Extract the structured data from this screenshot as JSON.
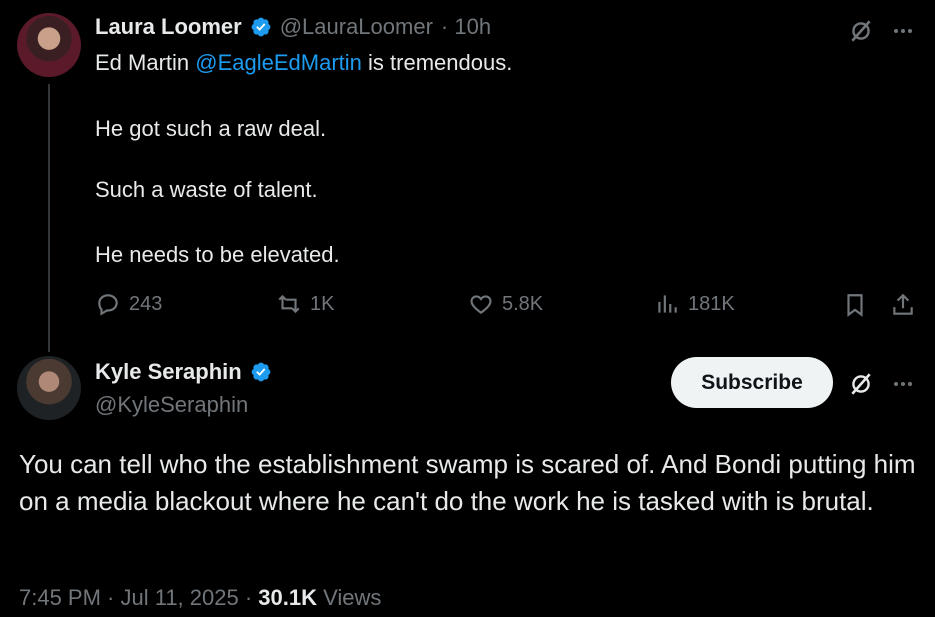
{
  "parent": {
    "name": "Laura Loomer",
    "handle": "@LauraLoomer",
    "time": "· 10h",
    "text_before": "Ed Martin",
    "mention": "@EagleEdMartin",
    "text_after": "is tremendous.",
    "paragraphs": [
      "He got such a raw deal.",
      "Such a waste of talent.",
      "He needs to be elevated."
    ],
    "stats": {
      "replies": "243",
      "reposts": "1K",
      "likes": "5.8K",
      "views": "181K"
    }
  },
  "reply": {
    "name": "Kyle Seraphin",
    "handle": "@KyleSeraphin",
    "subscribe_label": "Subscribe",
    "text": "You can tell who the establishment swamp is scared of. And Bondi putting him on a media blackout where he can't do the work he is tasked with is brutal.",
    "time": "7:45 PM · Jul 11, 2025 ·",
    "views_count": "30.1K",
    "views_label": "Views"
  },
  "colors": {
    "background": "#000000",
    "text": "#e7e9ea",
    "muted": "#71767b",
    "accent": "#1d9bf0"
  }
}
